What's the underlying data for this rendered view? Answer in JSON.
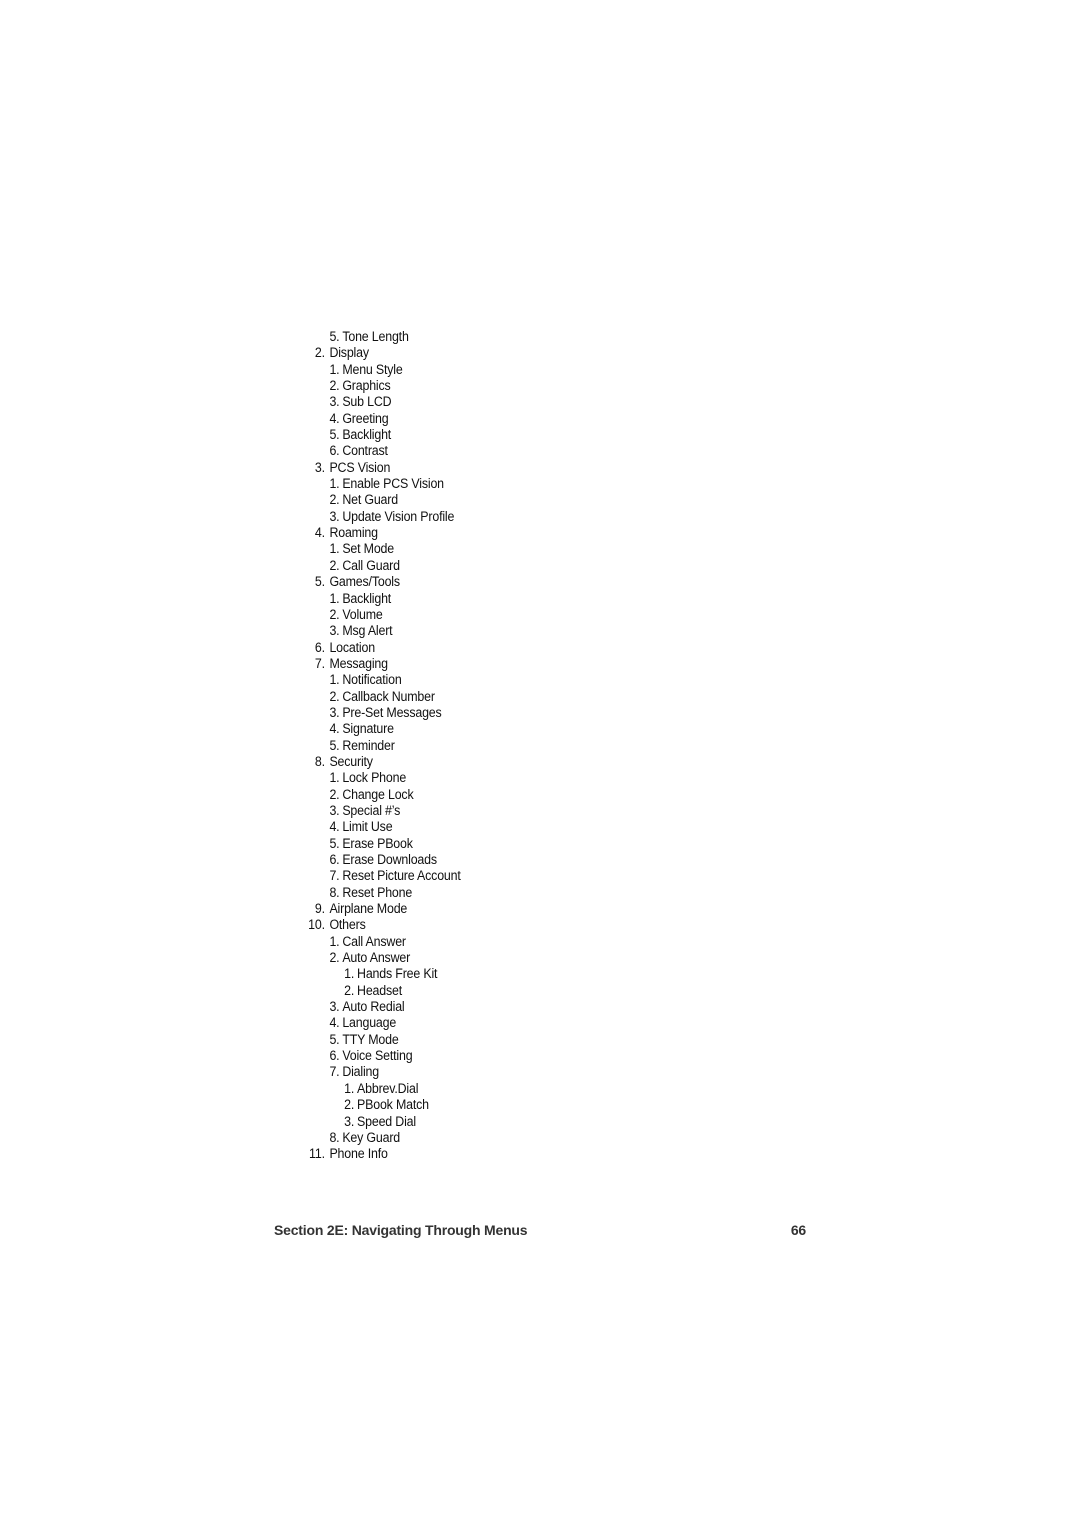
{
  "menu": [
    {
      "level": 2,
      "num": "5.",
      "label": "Tone Length"
    },
    {
      "level": 1,
      "num": "2.",
      "label": "Display"
    },
    {
      "level": 2,
      "num": "1.",
      "label": "Menu Style"
    },
    {
      "level": 2,
      "num": "2.",
      "label": "Graphics"
    },
    {
      "level": 2,
      "num": "3.",
      "label": "Sub LCD"
    },
    {
      "level": 2,
      "num": "4.",
      "label": "Greeting"
    },
    {
      "level": 2,
      "num": "5.",
      "label": "Backlight"
    },
    {
      "level": 2,
      "num": "6.",
      "label": "Contrast"
    },
    {
      "level": 1,
      "num": "3.",
      "label": "PCS Vision"
    },
    {
      "level": 2,
      "num": "1.",
      "label": "Enable PCS Vision"
    },
    {
      "level": 2,
      "num": "2.",
      "label": "Net Guard"
    },
    {
      "level": 2,
      "num": "3.",
      "label": "Update Vision Profile"
    },
    {
      "level": 1,
      "num": "4.",
      "label": "Roaming"
    },
    {
      "level": 2,
      "num": "1.",
      "label": "Set Mode"
    },
    {
      "level": 2,
      "num": "2.",
      "label": "Call Guard"
    },
    {
      "level": 1,
      "num": "5.",
      "label": "Games/Tools"
    },
    {
      "level": 2,
      "num": "1.",
      "label": "Backlight"
    },
    {
      "level": 2,
      "num": "2.",
      "label": "Volume"
    },
    {
      "level": 2,
      "num": "3.",
      "label": "Msg Alert"
    },
    {
      "level": 1,
      "num": "6.",
      "label": "Location"
    },
    {
      "level": 1,
      "num": "7.",
      "label": "Messaging"
    },
    {
      "level": 2,
      "num": "1.",
      "label": "Notification"
    },
    {
      "level": 2,
      "num": "2.",
      "label": "Callback Number"
    },
    {
      "level": 2,
      "num": "3.",
      "label": "Pre-Set Messages"
    },
    {
      "level": 2,
      "num": "4.",
      "label": "Signature"
    },
    {
      "level": 2,
      "num": "5.",
      "label": "Reminder"
    },
    {
      "level": 1,
      "num": "8.",
      "label": "Security"
    },
    {
      "level": 2,
      "num": "1.",
      "label": "Lock Phone"
    },
    {
      "level": 2,
      "num": "2.",
      "label": "Change Lock"
    },
    {
      "level": 2,
      "num": "3.",
      "label": "Special #’s"
    },
    {
      "level": 2,
      "num": "4.",
      "label": "Limit Use"
    },
    {
      "level": 2,
      "num": "5.",
      "label": "Erase PBook"
    },
    {
      "level": 2,
      "num": "6.",
      "label": "Erase Downloads"
    },
    {
      "level": 2,
      "num": "7.",
      "label": "Reset Picture Account"
    },
    {
      "level": 2,
      "num": "8.",
      "label": "Reset Phone"
    },
    {
      "level": 1,
      "num": "9.",
      "label": "Airplane Mode"
    },
    {
      "level": 1,
      "num": "10.",
      "label": "Others"
    },
    {
      "level": 2,
      "num": "1.",
      "label": "Call Answer"
    },
    {
      "level": 2,
      "num": "2.",
      "label": "Auto Answer"
    },
    {
      "level": 3,
      "num": "1.",
      "label": "Hands Free Kit"
    },
    {
      "level": 3,
      "num": "2.",
      "label": "Headset"
    },
    {
      "level": 2,
      "num": "3.",
      "label": "Auto Redial"
    },
    {
      "level": 2,
      "num": "4.",
      "label": "Language"
    },
    {
      "level": 2,
      "num": "5.",
      "label": "TTY Mode"
    },
    {
      "level": 2,
      "num": "6.",
      "label": "Voice Setting"
    },
    {
      "level": 2,
      "num": "7.",
      "label": "Dialing"
    },
    {
      "level": 3,
      "num": "1.",
      "label": "Abbrev.Dial"
    },
    {
      "level": 3,
      "num": "2.",
      "label": "PBook Match"
    },
    {
      "level": 3,
      "num": "3.",
      "label": "Speed Dial"
    },
    {
      "level": 2,
      "num": "8.",
      "label": "Key Guard"
    },
    {
      "level": 1,
      "num": "11.",
      "label": "Phone Info"
    }
  ],
  "footer": {
    "section_title": "Section 2E: Navigating Through Menus",
    "page_number": "66"
  }
}
